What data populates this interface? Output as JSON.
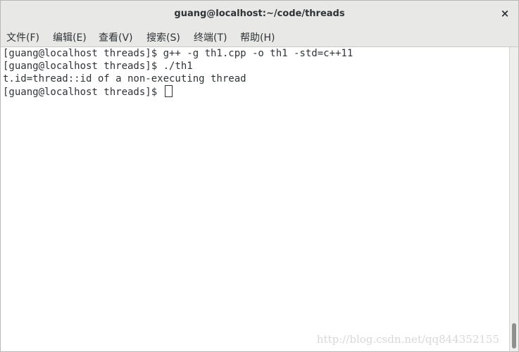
{
  "window": {
    "title": "guang@localhost:~/code/threads",
    "close_glyph": "×"
  },
  "menubar": {
    "items": [
      {
        "label": "文件(F)"
      },
      {
        "label": "编辑(E)"
      },
      {
        "label": "查看(V)"
      },
      {
        "label": "搜索(S)"
      },
      {
        "label": "终端(T)"
      },
      {
        "label": "帮助(H)"
      }
    ]
  },
  "terminal": {
    "lines": [
      "[guang@localhost threads]$ g++ -g th1.cpp -o th1 -std=c++11",
      "[guang@localhost threads]$ ./th1",
      "t.id=thread::id of a non-executing thread",
      "[guang@localhost threads]$ "
    ]
  },
  "watermark": {
    "text": "http://blog.csdn.net/qq844352155"
  },
  "icons": {
    "close": "close-icon",
    "cursor": "block-cursor"
  },
  "colors": {
    "title_bar_bg": "#e8e8e7",
    "terminal_bg": "#ffffff",
    "terminal_fg": "#2e3436",
    "scroll_thumb": "#8f8f8d"
  }
}
